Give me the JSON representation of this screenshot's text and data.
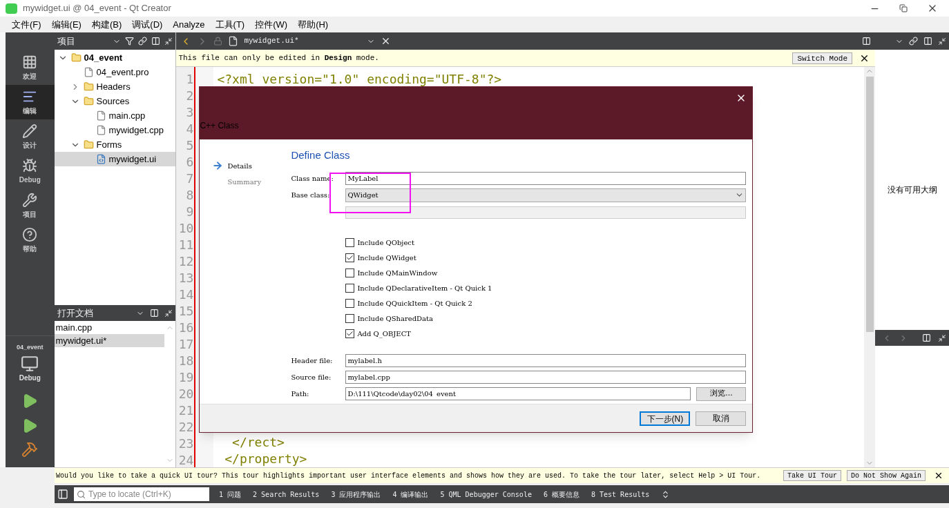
{
  "window": {
    "title": "mywidget.ui @ 04_event - Qt Creator"
  },
  "menu": [
    "文件(F)",
    "编辑(E)",
    "构建(B)",
    "调试(D)",
    "Analyze",
    "工具(T)",
    "控件(W)",
    "帮助(H)"
  ],
  "mode_bar": {
    "items": [
      {
        "label": "欢迎",
        "selected": false
      },
      {
        "label": "编辑",
        "selected": true
      },
      {
        "label": "设计",
        "selected": false
      },
      {
        "label": "Debug",
        "selected": false
      },
      {
        "label": "项目",
        "selected": false
      },
      {
        "label": "帮助",
        "selected": false
      }
    ],
    "kit": {
      "project": "04_event",
      "config": "Debug"
    }
  },
  "project_panel": {
    "title": "项目",
    "tree": [
      {
        "label": "04_event",
        "kind": "project",
        "expanded": true,
        "selected": false,
        "children": [
          {
            "label": "04_event.pro",
            "kind": "file",
            "selected": false
          },
          {
            "label": "Headers",
            "kind": "folder",
            "expanded": false,
            "selected": false
          },
          {
            "label": "Sources",
            "kind": "folder",
            "expanded": true,
            "selected": false,
            "children": [
              {
                "label": "main.cpp",
                "kind": "file",
                "selected": false
              },
              {
                "label": "mywidget.cpp",
                "kind": "file",
                "selected": false
              }
            ]
          },
          {
            "label": "Forms",
            "kind": "folder",
            "expanded": true,
            "selected": false,
            "children": [
              {
                "label": "mywidget.ui",
                "kind": "form",
                "selected": true
              }
            ]
          }
        ]
      }
    ]
  },
  "open_documents": {
    "title": "打开文档",
    "items": [
      {
        "label": "main.cpp",
        "selected": false
      },
      {
        "label": "mywidget.ui*",
        "selected": true
      }
    ]
  },
  "editor": {
    "tab": "mywidget.ui*",
    "info_bar": {
      "text": "This file can only be edited in **Design** mode.",
      "button": "Switch Mode"
    },
    "lines": [
      {
        "number": "1",
        "code": "<?xml version=\"1.0\" encoding=\"UTF-8\"?>"
      },
      {
        "number": "2"
      },
      {
        "number": "3"
      },
      {
        "number": "4"
      },
      {
        "number": "5"
      },
      {
        "number": "6"
      },
      {
        "number": "7"
      },
      {
        "number": "8"
      },
      {
        "number": "9"
      },
      {
        "number": "10"
      },
      {
        "number": "11"
      },
      {
        "number": "12"
      },
      {
        "number": "13"
      },
      {
        "number": "14"
      },
      {
        "number": "15"
      },
      {
        "number": "16"
      },
      {
        "number": "17"
      },
      {
        "number": "18"
      },
      {
        "number": "19"
      },
      {
        "number": "20"
      },
      {
        "number": "21"
      },
      {
        "number": "22"
      },
      {
        "number": "23",
        "code": "  </rect>"
      },
      {
        "number": "24",
        "code": " </property>"
      }
    ]
  },
  "outline": {
    "empty_text": "没有可用大纲"
  },
  "dialog": {
    "title": "C++ Class",
    "steps": [
      {
        "label": "Details",
        "selected": true
      },
      {
        "label": "Summary",
        "selected": false
      }
    ],
    "heading": "Define Class",
    "class_name": {
      "label": "Class name:",
      "value": "MyLabel"
    },
    "base_class": {
      "label": "Base class:",
      "value": "QWidget"
    },
    "checkboxes": [
      {
        "label": "Include QObject",
        "checked": false
      },
      {
        "label": "Include QWidget",
        "checked": true
      },
      {
        "label": "Include QMainWindow",
        "checked": false
      },
      {
        "label": "Include QDeclarativeItem - Qt Quick 1",
        "checked": false
      },
      {
        "label": "Include QQuickItem - Qt Quick 2",
        "checked": false
      },
      {
        "label": "Include QSharedData",
        "checked": false
      },
      {
        "label": "Add Q_OBJECT",
        "checked": true
      }
    ],
    "files": [
      {
        "label": "Header file:",
        "value": "mylabel.h"
      },
      {
        "label": "Source file:",
        "value": "mylabel.cpp"
      },
      {
        "label": "Path:",
        "value": "D:\\111\\Qtcode\\day02\\04_event",
        "button": "浏览..."
      }
    ],
    "buttons": [
      {
        "label": "下一步(N)",
        "primary": true
      },
      {
        "label": "取消",
        "primary": false
      }
    ]
  },
  "tour_bar": {
    "text": "Would you like to take a quick UI tour? This tour highlights important user interface elements and shows how they are used. To take the tour later, select Help > UI Tour.",
    "buttons": [
      "Take UI Tour",
      "Do Not Show Again"
    ]
  },
  "status_bar": {
    "search_placeholder": "Type to locate (Ctrl+K)",
    "tabs": [
      "1 问题",
      "2 Search Results",
      "3 应用程序输出",
      "4 编译输出",
      "5 QML Debugger Console",
      "6 概要信息",
      "8 Test Results"
    ]
  }
}
